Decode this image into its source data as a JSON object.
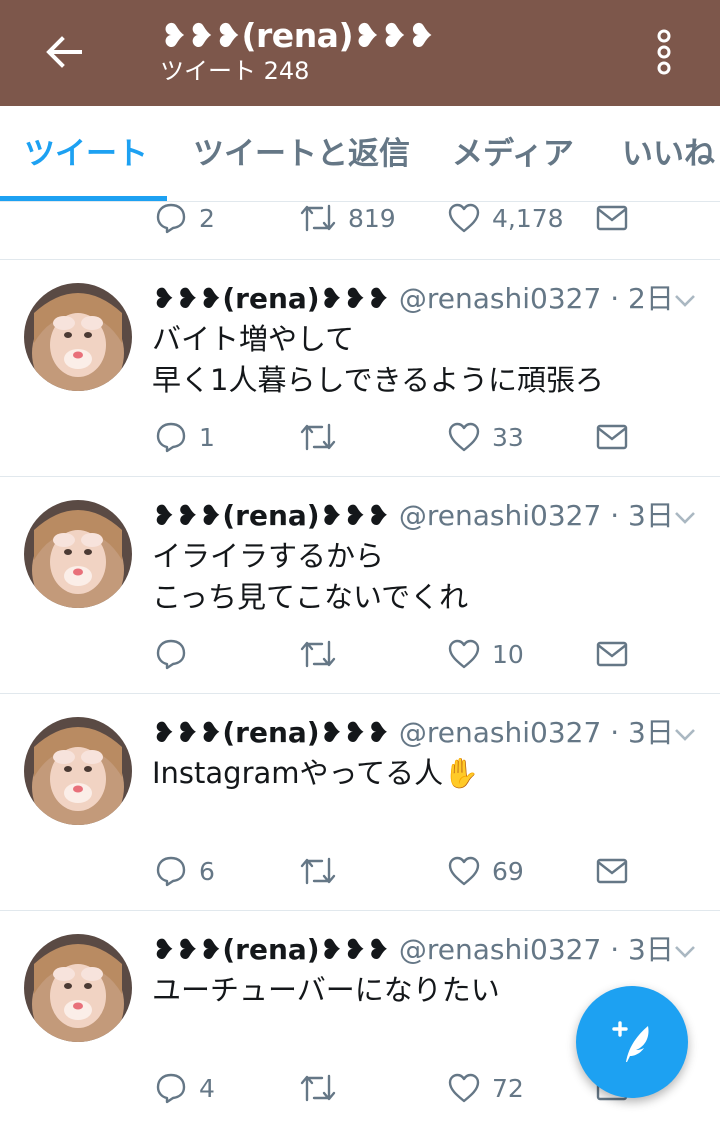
{
  "header": {
    "back_icon": "arrow-left-icon",
    "title": "❥❥❥(rena)❥❥❥",
    "subtitle": "ツイート 248",
    "more_icon": "more-vertical-icon",
    "color": "#7d574b"
  },
  "tabs": [
    {
      "label": "ツイート",
      "active": true
    },
    {
      "label": "ツイートと返信",
      "active": false
    },
    {
      "label": "メディア",
      "active": false
    },
    {
      "label": "いいね",
      "active": false
    }
  ],
  "accent_color": "#1da1f2",
  "partial_tweet": {
    "replies": "2",
    "retweets": "819",
    "likes": "4,178"
  },
  "tweets": [
    {
      "name": "❥❥❥(rena)❥❥❥",
      "handle": "@renashi0327 · 2日",
      "lines": [
        "バイト増やして",
        "早く1人暮らしできるように頑張ろ"
      ],
      "replies": "1",
      "retweets": "",
      "likes": "33"
    },
    {
      "name": "❥❥❥(rena)❥❥❥",
      "handle": "@renashi0327 · 3日",
      "lines": [
        "イライラするから",
        "こっち見てこないでくれ"
      ],
      "replies": "",
      "retweets": "",
      "likes": "10"
    },
    {
      "name": "❥❥❥(rena)❥❥❥",
      "handle": "@renashi0327 · 3日",
      "lines": [
        "Instagramやってる人✋"
      ],
      "replies": "6",
      "retweets": "",
      "likes": "69"
    },
    {
      "name": "❥❥❥(rena)❥❥❥",
      "handle": "@renashi0327 · 3日",
      "lines": [
        "ユーチューバーになりたい"
      ],
      "replies": "4",
      "retweets": "",
      "likes": "72"
    }
  ],
  "fab_icon": "compose-tweet-icon"
}
